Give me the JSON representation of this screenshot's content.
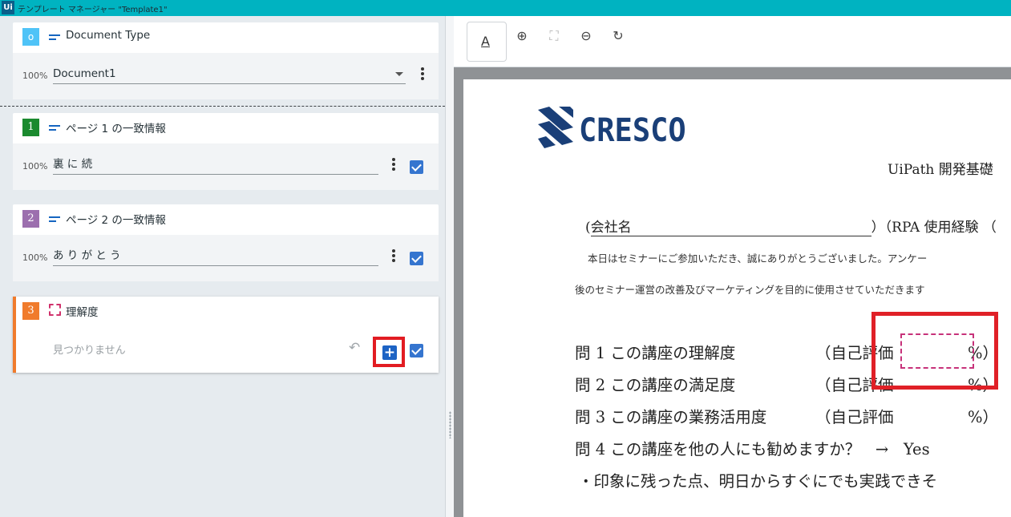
{
  "window": {
    "logo": "Ui",
    "title": "テンプレート マネージャー \"Template1\""
  },
  "left_panel": {
    "document_type": {
      "badge": "o",
      "badge_color": "#4fc3f7",
      "label": "Document Type",
      "confidence": "100%",
      "value": "Document1"
    },
    "fields": [
      {
        "badge": "1",
        "badge_color": "#1b8a2f",
        "label": "ページ 1 の一致情報",
        "confidence": "100%",
        "value": "裏 に 続",
        "checked": true
      },
      {
        "badge": "2",
        "badge_color": "#9c6fae",
        "label": "ページ 2 の一致情報",
        "confidence": "100%",
        "value": "あ り が と う",
        "checked": true
      },
      {
        "badge": "3",
        "badge_color": "#f07b2c",
        "label": "理解度",
        "value": "見つかりません",
        "checked": true,
        "add_icon": "+",
        "undo_icon": "undo-icon"
      }
    ]
  },
  "toolbar": {
    "text_tool": "A",
    "zoom_in": "⊕",
    "fit": "⛶",
    "zoom_out": "⊖",
    "rotate": "↻"
  },
  "document": {
    "logo_text": "CRESCO",
    "title": "UiPath 開発基礎",
    "company_prefix": "(",
    "company_label": "会社名",
    "rpa_experience": "）（RPA 使用経験 （",
    "intro_line1": "本日はセミナーにご参加いただき、誠にありがとうございました。アンケー",
    "intro_line2": "後のセミナー運営の改善及びマーケティングを目的に使用させていただきます",
    "questions": [
      {
        "label": "問 1 この講座の理解度",
        "eval": "（自己評価",
        "end": "%）"
      },
      {
        "label": "問 2 この講座の満足度",
        "eval": "（自己評価",
        "end": "%）"
      },
      {
        "label": "問 3 この講座の業務活用度",
        "eval": "（自己評価",
        "end": "%）"
      },
      {
        "label": "問 4 この講座を他の人にも勧めますか？",
        "eval": "→",
        "end": "Yes"
      }
    ],
    "impression": "・印象に残った点、明日からすぐにでも実践できそ"
  }
}
